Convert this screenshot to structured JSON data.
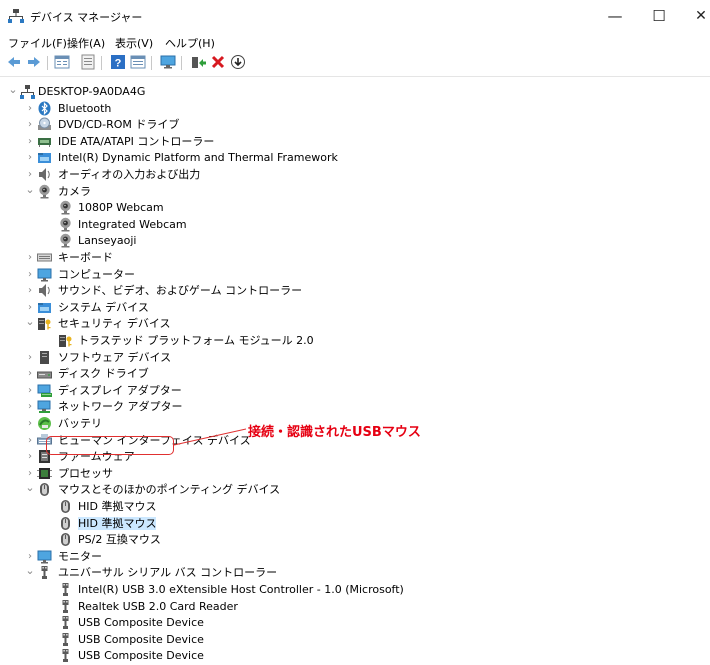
{
  "window": {
    "title": "デバイス マネージャー",
    "minimize_glyph": "—",
    "maximize_glyph": "☐",
    "close_glyph": "✕"
  },
  "menu": [
    "ファイル(F)",
    "操作(A)",
    "表示(V)",
    "ヘルプ(H)"
  ],
  "toolbar": {
    "buttons": [
      "back-icon",
      "forward-icon",
      "properties-icon",
      "list-view-icon",
      "help-icon",
      "resources-icon",
      "monitor-icon",
      "update-driver-icon",
      "uninstall-icon",
      "enable-device-icon"
    ]
  },
  "tree": [
    {
      "label": "DESKTOP-9A0DA4G",
      "state": "expanded",
      "icon": "computer-icon"
    },
    {
      "label": "Bluetooth",
      "state": "collapsed",
      "icon": "bluetooth-icon"
    },
    {
      "label": "DVD/CD-ROM ドライブ",
      "state": "collapsed",
      "icon": "dvd-drive-icon"
    },
    {
      "label": "IDE ATA/ATAPI コントローラー",
      "state": "collapsed",
      "icon": "ide-controller-icon"
    },
    {
      "label": "Intel(R) Dynamic Platform and Thermal Framework",
      "state": "collapsed",
      "icon": "system-folder-icon"
    },
    {
      "label": "オーディオの入力および出力",
      "state": "collapsed",
      "icon": "speaker-icon"
    },
    {
      "label": "カメラ",
      "state": "expanded",
      "icon": "webcam-icon"
    },
    {
      "label": "1080P Webcam",
      "state": "leaf",
      "icon": "webcam-icon"
    },
    {
      "label": "Integrated Webcam",
      "state": "leaf",
      "icon": "webcam-icon"
    },
    {
      "label": "Lanseyaoji",
      "state": "leaf",
      "icon": "webcam-icon"
    },
    {
      "label": "キーボード",
      "state": "collapsed",
      "icon": "keyboard-icon"
    },
    {
      "label": "コンピューター",
      "state": "collapsed",
      "icon": "monitor-icon"
    },
    {
      "label": "サウンド、ビデオ、およびゲーム コントローラー",
      "state": "collapsed",
      "icon": "speaker-icon"
    },
    {
      "label": "システム デバイス",
      "state": "collapsed",
      "icon": "system-folder-icon"
    },
    {
      "label": "セキュリティ デバイス",
      "state": "expanded",
      "icon": "security-key-icon"
    },
    {
      "label": "トラステッド プラットフォーム モジュール 2.0",
      "state": "leaf",
      "icon": "security-key-icon"
    },
    {
      "label": "ソフトウェア デバイス",
      "state": "collapsed",
      "icon": "software-device-icon"
    },
    {
      "label": "ディスク ドライブ",
      "state": "collapsed",
      "icon": "disk-drive-icon"
    },
    {
      "label": "ディスプレイ アダプター",
      "state": "collapsed",
      "icon": "display-adapter-icon"
    },
    {
      "label": "ネットワーク アダプター",
      "state": "collapsed",
      "icon": "network-adapter-icon"
    },
    {
      "label": "バッテリ",
      "state": "collapsed",
      "icon": "battery-icon"
    },
    {
      "label": "ヒューマン インターフェイス デバイス",
      "state": "collapsed",
      "icon": "hid-icon"
    },
    {
      "label": "ファームウェア",
      "state": "collapsed",
      "icon": "firmware-icon"
    },
    {
      "label": "プロセッサ",
      "state": "collapsed",
      "icon": "processor-icon"
    },
    {
      "label": "マウスとそのほかのポインティング デバイス",
      "state": "expanded",
      "icon": "mouse-icon"
    },
    {
      "label": "HID 準拠マウス",
      "state": "leaf",
      "icon": "mouse-icon"
    },
    {
      "label": "HID 準拠マウス",
      "state": "leaf",
      "icon": "mouse-icon",
      "highlighted": true
    },
    {
      "label": "PS/2 互換マウス",
      "state": "leaf",
      "icon": "mouse-icon"
    },
    {
      "label": "モニター",
      "state": "collapsed",
      "icon": "monitor-icon"
    },
    {
      "label": "ユニバーサル シリアル バス コントローラー",
      "state": "expanded",
      "icon": "usb-icon"
    },
    {
      "label": "Intel(R) USB 3.0 eXtensible Host Controller - 1.0 (Microsoft)",
      "state": "leaf",
      "icon": "usb-icon"
    },
    {
      "label": "Realtek USB 2.0 Card Reader",
      "state": "leaf",
      "icon": "usb-icon"
    },
    {
      "label": "USB Composite Device",
      "state": "leaf",
      "icon": "usb-icon"
    },
    {
      "label": "USB Composite Device",
      "state": "leaf",
      "icon": "usb-icon"
    },
    {
      "label": "USB Composite Device",
      "state": "leaf",
      "icon": "usb-icon"
    }
  ],
  "annotation": {
    "text": "接続・認識されたUSBマウス",
    "color": "#e60012"
  }
}
